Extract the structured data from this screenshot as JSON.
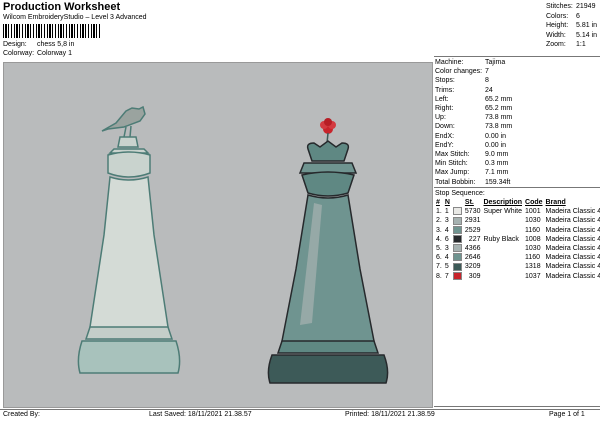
{
  "header": {
    "title": "Production Worksheet",
    "subtitle": "Wilcom EmbroideryStudio – Level 3 Advanced",
    "design_label": "Design:",
    "design_value": "chess 5,8 in",
    "colorway_label": "Colorway:",
    "colorway_value": "Colorway 1"
  },
  "stats": [
    {
      "label": "Stitches:",
      "value": "21949"
    },
    {
      "label": "Colors:",
      "value": "6"
    },
    {
      "label": "Height:",
      "value": "5.81 in"
    },
    {
      "label": "Width:",
      "value": "5.14 in"
    },
    {
      "label": "Zoom:",
      "value": "1:1"
    }
  ],
  "machine": [
    {
      "label": "Machine:",
      "value": "Tajima"
    },
    {
      "label": "Color changes:",
      "value": "7"
    },
    {
      "label": "Stops:",
      "value": "8"
    },
    {
      "label": "Trims:",
      "value": "24"
    },
    {
      "label": "Left:",
      "value": "65.2 mm"
    },
    {
      "label": "Right:",
      "value": "65.2 mm"
    },
    {
      "label": "Up:",
      "value": "73.8 mm"
    },
    {
      "label": "Down:",
      "value": "73.8 mm"
    },
    {
      "label": "EndX:",
      "value": "0.00 in"
    },
    {
      "label": "EndY:",
      "value": "0.00 in"
    },
    {
      "label": "Max Stitch:",
      "value": "9.0 mm"
    },
    {
      "label": "Min Stitch:",
      "value": "0.3 mm"
    },
    {
      "label": "Max Jump:",
      "value": "7.1 mm"
    },
    {
      "label": "Total Bobbin:",
      "value": "159.34ft"
    }
  ],
  "stop_sequence": {
    "title": "Stop Sequence:",
    "headers": [
      "#",
      "N",
      "St.",
      "Description",
      "Code",
      "Brand"
    ],
    "rows": [
      {
        "num": "1.",
        "n": "1",
        "color": "#e9e9e6",
        "st": "5730",
        "desc": "Super White",
        "code": "1001",
        "brand": "Madeira Classic 40"
      },
      {
        "num": "2.",
        "n": "3",
        "color": "#a6b2b1",
        "st": "2931",
        "desc": "",
        "code": "1030",
        "brand": "Madeira Classic 40"
      },
      {
        "num": "3.",
        "n": "4",
        "color": "#6f9490",
        "st": "2529",
        "desc": "",
        "code": "1160",
        "brand": "Madeira Classic 40"
      },
      {
        "num": "4.",
        "n": "6",
        "color": "#26292c",
        "st": "227",
        "desc": "Ruby Black",
        "code": "1008",
        "brand": "Madeira Classic 40"
      },
      {
        "num": "5.",
        "n": "3",
        "color": "#a6b2b1",
        "st": "4366",
        "desc": "",
        "code": "1030",
        "brand": "Madeira Classic 40"
      },
      {
        "num": "6.",
        "n": "4",
        "color": "#6f9490",
        "st": "2646",
        "desc": "",
        "code": "1160",
        "brand": "Madeira Classic 40"
      },
      {
        "num": "7.",
        "n": "5",
        "color": "#3d5a58",
        "st": "3209",
        "desc": "",
        "code": "1318",
        "brand": "Madeira Classic 40"
      },
      {
        "num": "8.",
        "n": "7",
        "color": "#c8242b",
        "st": "309",
        "desc": "",
        "code": "1037",
        "brand": "Madeira Classic 40"
      }
    ]
  },
  "footer": {
    "created": "Created By:",
    "saved": "Last Saved: 18/11/2021 21.38.57",
    "printed": "Printed: 18/11/2021 21.38.59",
    "page": "Page 1 of 1"
  }
}
